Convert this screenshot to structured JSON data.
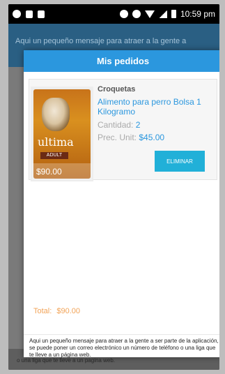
{
  "status_bar": {
    "time": "10:59 pm"
  },
  "background": {
    "header_text": "Aqui un pequeño mensaje para atraer a la gente a",
    "bottom_text": "o una liga que te lleve a un pagina web."
  },
  "modal": {
    "title": "Mis pedidos",
    "order": {
      "category": "Croquetas",
      "product_name": "Alimento para perro Bolsa 1 Kilogramo",
      "quantity_label": "Cantidad:",
      "quantity_value": "2",
      "unit_price_label": "Prec. Unit:",
      "unit_price_value": "$45.00",
      "image_brand": "ultima",
      "image_badge": "ADULT",
      "image_price": "$90.00",
      "delete_button": "ELIMINAR"
    },
    "total_label": "Total:",
    "total_value": "$90.00",
    "footer_text": "Aqui un pequeño mensaje para atraer a la gente a ser parte de la aplicación, se puede poner un correo electrónico un número de teléfono o una liga que te lleve a un página web."
  },
  "colors": {
    "header": "#2b97de",
    "accent": "#21b0d8",
    "total": "#f2a357"
  },
  "icons": [
    "chat-icon",
    "usb-icon",
    "android-icon",
    "headphones-icon",
    "location-icon",
    "wifi-icon",
    "signal-icon",
    "battery-icon",
    "dog-food-bag-image"
  ]
}
